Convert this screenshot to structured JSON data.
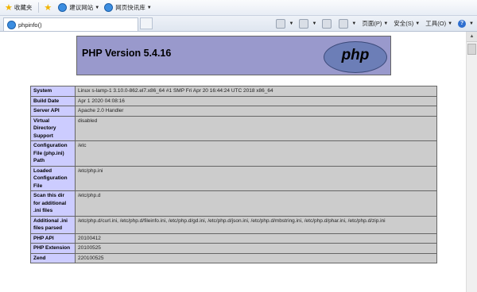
{
  "favorites_bar": {
    "favorites_label": "收藏夹",
    "suggested_sites": "建议网站",
    "web_slice_gallery": "网页快讯库"
  },
  "tab": {
    "title": "phpinfo()"
  },
  "toolbar": {
    "page": "页面(P)",
    "safety": "安全(S)",
    "tools": "工具(O)"
  },
  "header": {
    "title": "PHP Version 5.4.16",
    "logo_text": "php"
  },
  "rows": [
    {
      "key": "System",
      "value": "Linux s-lamp-1 3.10.0-862.el7.x86_64 #1 SMP Fri Apr 20 16:44:24 UTC 2018 x86_64"
    },
    {
      "key": "Build Date",
      "value": "Apr 1 2020 04:08:16"
    },
    {
      "key": "Server API",
      "value": "Apache 2.0 Handler"
    },
    {
      "key": "Virtual Directory Support",
      "value": "disabled"
    },
    {
      "key": "Configuration File (php.ini) Path",
      "value": "/etc"
    },
    {
      "key": "Loaded Configuration File",
      "value": "/etc/php.ini"
    },
    {
      "key": "Scan this dir for additional .ini files",
      "value": "/etc/php.d"
    },
    {
      "key": "Additional .ini files parsed",
      "value": "/etc/php.d/curl.ini, /etc/php.d/fileinfo.ini, /etc/php.d/gd.ini, /etc/php.d/json.ini, /etc/php.d/mbstring.ini, /etc/php.d/phar.ini, /etc/php.d/zip.ini"
    },
    {
      "key": "PHP API",
      "value": "20100412"
    },
    {
      "key": "PHP Extension",
      "value": "20100525"
    },
    {
      "key": "Zend",
      "value": "220100525"
    }
  ]
}
